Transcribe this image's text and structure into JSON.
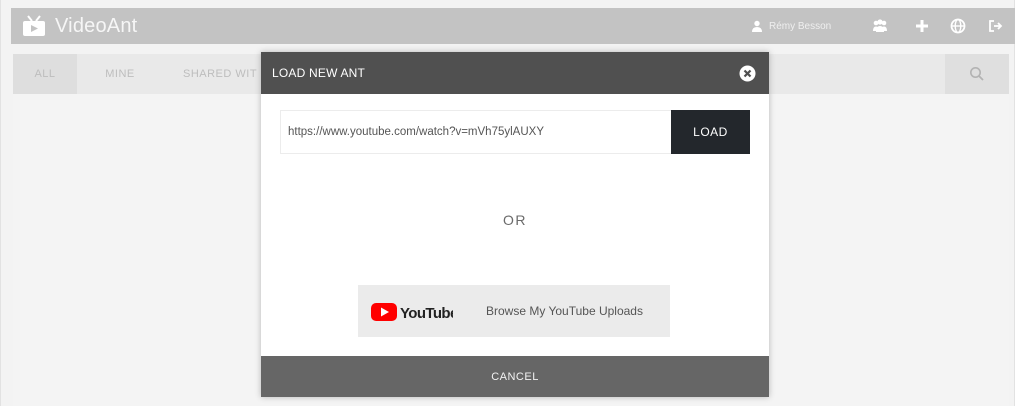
{
  "app": {
    "title": "VideoAnt",
    "user_name": "Rémy Besson",
    "header_icons": [
      "groups-icon",
      "plus-icon",
      "globe-icon",
      "logout-icon"
    ]
  },
  "filters": {
    "tabs": [
      {
        "label": "ALL",
        "active": true
      },
      {
        "label": "MINE",
        "active": false
      },
      {
        "label": "SHARED WIT",
        "active": false
      }
    ],
    "search_icon": "search-icon"
  },
  "modal": {
    "title": "LOAD NEW ANT",
    "url_value": "https://www.youtube.com/watch?v=mVh75ylAUXY",
    "load_label": "LOAD",
    "or_label": "OR",
    "youtube_brand": "YouTube",
    "youtube_label": "Browse My YouTube Uploads",
    "cancel_label": "CANCEL"
  },
  "colors": {
    "header_bg": "#c3c3c3",
    "modal_header": "#505050",
    "load_button": "#23272c",
    "modal_footer": "#666666",
    "youtube_red": "#ff0000"
  }
}
